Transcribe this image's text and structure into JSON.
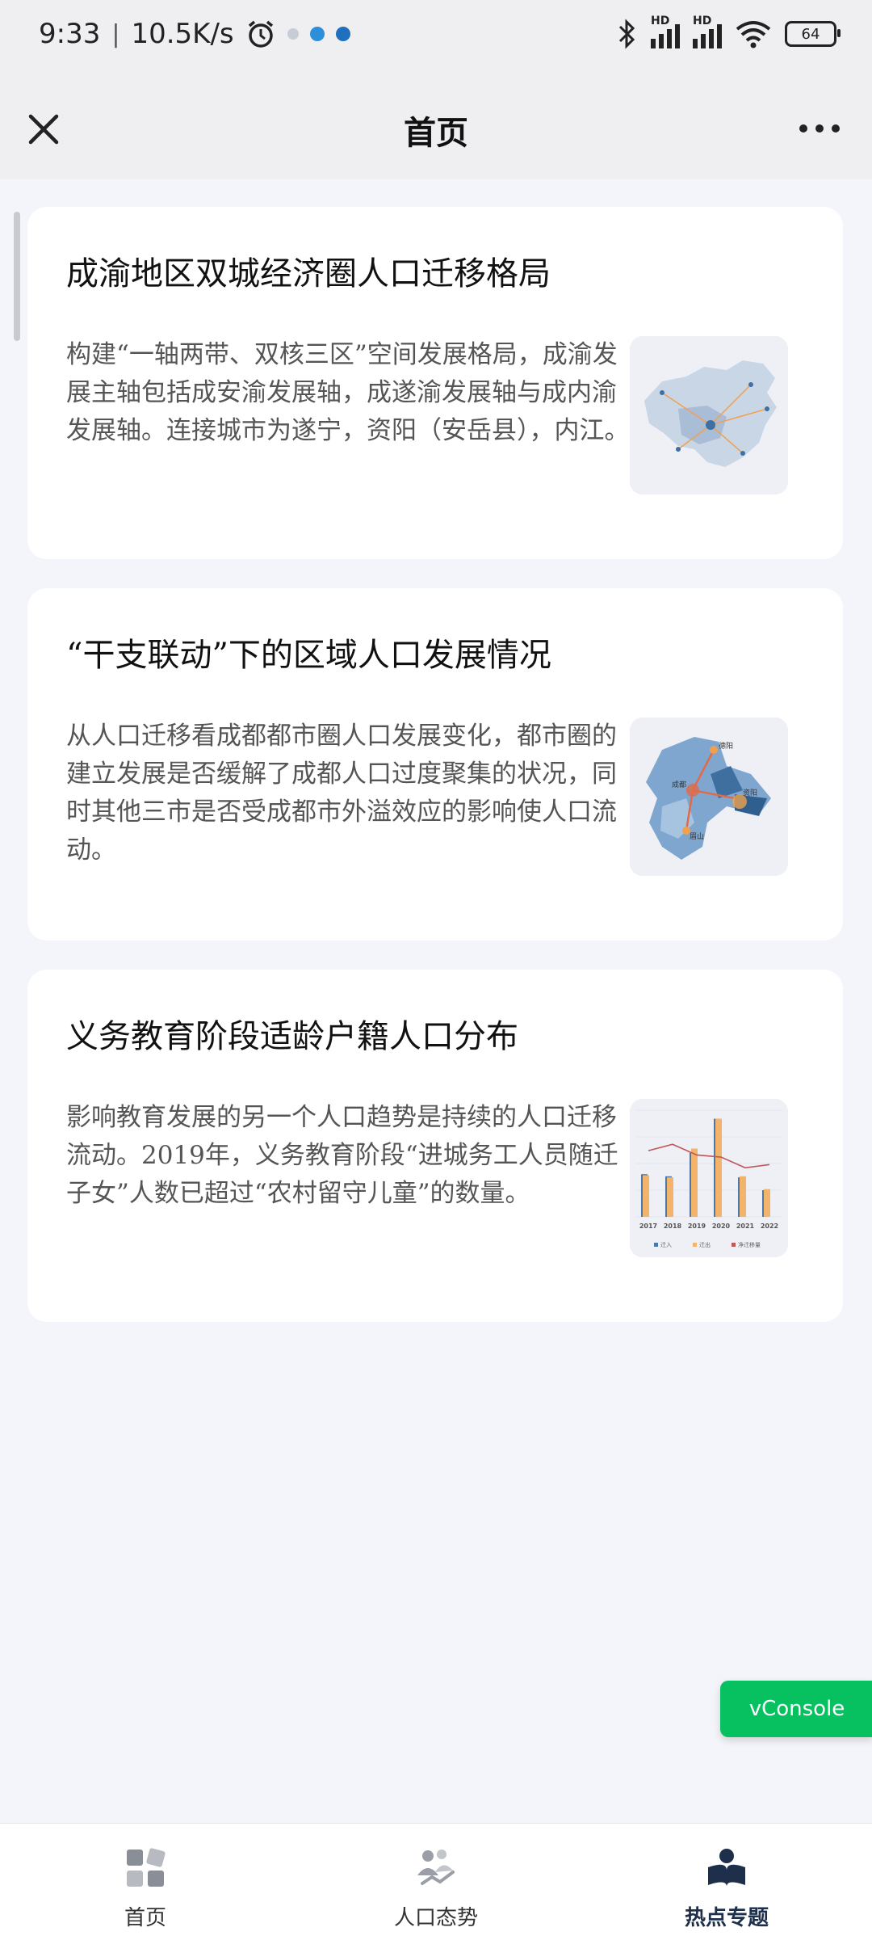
{
  "status": {
    "time": "9:33",
    "speed": "10.5K/s",
    "battery": "64"
  },
  "header": {
    "title": "首页"
  },
  "cards": [
    {
      "title": "成渝地区双城经济圈人口迁移格局",
      "desc": "构建“一轴两带、双核三区”空间发展格局，成渝发展主轴包括成安渝发展轴，成遂渝发展轴与成内渝发展轴。连接城市为遂宁，资阳（安岳县），内江。"
    },
    {
      "title": "“干支联动”下的区域人口发展情况",
      "desc": "从人口迁移看成都都市圈人口发展变化，都市圈的建立发展是否缓解了成都人口过度聚集的状况，同时其他三市是否受成都市外溢效应的影响使人口流动。",
      "map_labels": [
        "德阳",
        "成都",
        "资阳",
        "眉山"
      ]
    },
    {
      "title": "义务教育阶段适龄户籍人口分布",
      "desc": "影响教育发展的另一个人口趋势是持续的人口迁移流动。2019年，义务教育阶段“进城务工人员随迁子女”人数已超过“农村留守儿童”的数量。",
      "chart": {
        "years": [
          "2017",
          "2018",
          "2019",
          "2020",
          "2021",
          "2022"
        ],
        "legend": [
          "迁入",
          "迁出",
          "净迁移量"
        ]
      }
    }
  ],
  "chart_data": {
    "type": "bar",
    "categories": [
      "2017",
      "2018",
      "2019",
      "2020",
      "2021",
      "2022"
    ],
    "series": [
      {
        "name": "迁入",
        "values": [
          40,
          38,
          60,
          92,
          37,
          25
        ]
      },
      {
        "name": "迁出",
        "values": [
          39,
          37,
          64,
          92,
          38,
          26
        ]
      },
      {
        "name": "净迁移量",
        "values": [
          62,
          68,
          58,
          56,
          46,
          49
        ]
      }
    ],
    "legend_position": "bottom",
    "colors": [
      "#4a78a8",
      "#f2b46a",
      "#c0565a"
    ]
  },
  "vconsole": "vConsole",
  "tabs": [
    {
      "label": "首页"
    },
    {
      "label": "人口态势"
    },
    {
      "label": "热点专题"
    }
  ]
}
